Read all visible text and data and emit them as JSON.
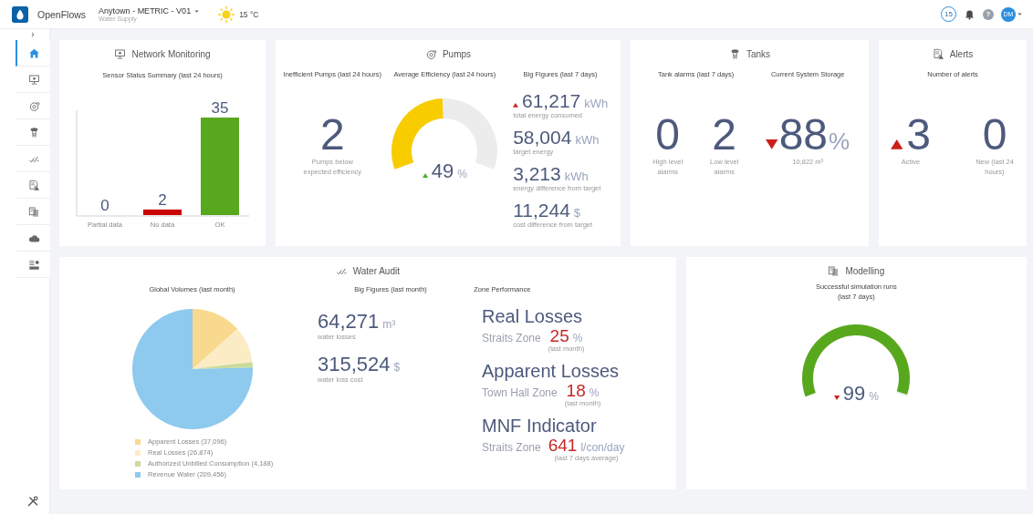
{
  "header": {
    "app_name": "OpenFlows",
    "project": "Anytown - METRIC - V01",
    "project_subtitle": "Water Supply",
    "temperature": "15 °C",
    "notification_count": "15",
    "help": "?",
    "user_initials": "DM"
  },
  "sidebar": {
    "toggle": "›",
    "items": [
      {
        "selected": true
      },
      {
        "selected": false
      },
      {
        "selected": false
      },
      {
        "selected": false
      },
      {
        "selected": false
      },
      {
        "selected": false
      },
      {
        "selected": false
      },
      {
        "selected": false
      },
      {
        "selected": false
      }
    ]
  },
  "network_monitoring": {
    "title": "Network Monitoring",
    "subtitle": "Sensor Status Summary (last 24 hours)",
    "chart_data": {
      "type": "bar",
      "categories": [
        "Partial data",
        "No data",
        "OK"
      ],
      "values": [
        0,
        2,
        35
      ],
      "colors": [
        null,
        "#cc0000",
        "#58a81e"
      ],
      "data_labels": true
    }
  },
  "pumps": {
    "title": "Pumps",
    "inefficient": {
      "heading": "Inefficient Pumps (last 24 hours)",
      "value": "2",
      "caption": "Pumps below expected efficiency"
    },
    "efficiency": {
      "heading": "Average Efficiency (last 24 hours)",
      "level": 0.49,
      "value": "49",
      "unit": "%",
      "rising": true,
      "good": true
    },
    "big_figures": {
      "heading": "Big Figures (last 7 days)",
      "items": [
        {
          "value": "61,217",
          "unit": "kWh",
          "caption": "total energy consumed",
          "rising": true,
          "good": false
        },
        {
          "value": "58,004",
          "unit": "kWh",
          "caption": "target energy"
        },
        {
          "value": "3,213",
          "unit": "kWh",
          "caption": "energy difference from target"
        },
        {
          "value": "11,244",
          "unit": "$",
          "caption": "cost difference from target"
        }
      ]
    }
  },
  "tanks": {
    "title": "Tanks",
    "alarms": {
      "heading": "Tank alarms (last 7 days)",
      "items": [
        {
          "value": "0",
          "caption": "High level alarms"
        },
        {
          "value": "2",
          "caption": "Low level alarms"
        }
      ]
    },
    "storage": {
      "heading": "Current System Storage",
      "value": "88",
      "unit": "%",
      "rising": false,
      "good": false,
      "caption": "10,822 m³"
    }
  },
  "alerts": {
    "title": "Alerts",
    "heading": "Number of alerts",
    "items": [
      {
        "value": "3",
        "caption": "Active",
        "rising": true,
        "good": false
      },
      {
        "value": "0",
        "caption": "New (last 24 hours)"
      }
    ]
  },
  "water_audit": {
    "title": "Water Audit",
    "global_volumes": {
      "heading": "Global Volumes (last month)",
      "chart_data": {
        "type": "pie",
        "values": [
          13.4,
          9.7,
          1.5,
          75.4
        ],
        "colors": [
          "#f8d98e",
          "#fcecc6",
          "#c9dc9a",
          "#8ec9ee"
        ]
      },
      "legend": [
        "Apparent Losses (37,096)",
        "Real Losses (26,874)",
        "Authorized Unbilled Consumption (4,188)",
        "Revenue Water (209,456)"
      ]
    },
    "big_figures": {
      "heading": "Big Figures (last month)",
      "items": [
        {
          "value": "64,271",
          "unit": "m³",
          "caption": "water losses"
        },
        {
          "value": "315,524",
          "unit": "$",
          "caption": "water loss cost"
        }
      ]
    },
    "zone_performance": {
      "heading": "Zone Performance",
      "items": [
        {
          "title": "Real Losses",
          "zone": "Straits Zone",
          "value": "25",
          "unit": "%",
          "note": "(last month)"
        },
        {
          "title": "Apparent Losses",
          "zone": "Town Hall Zone",
          "value": "18",
          "unit": "%",
          "note": "(last month)"
        },
        {
          "title": "MNF Indicator",
          "zone": "Straits Zone",
          "value": "641",
          "unit": "l/con/day",
          "note": "(last 7 days average)"
        }
      ]
    }
  },
  "modelling": {
    "title": "Modelling",
    "subtitle": "Successful simulation runs (last 7 days)",
    "level": 0.99,
    "value": "99",
    "unit": "%",
    "rising": false,
    "good": false
  }
}
